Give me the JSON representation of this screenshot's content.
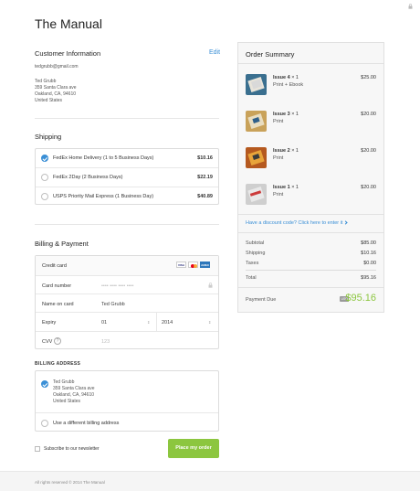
{
  "page": {
    "title": "The Manual"
  },
  "customer": {
    "heading": "Customer Information",
    "edit_label": "Edit",
    "email": "tedgrubb@gmail.com",
    "address_lines": [
      "Ted Grubb",
      "359 Santa Clara ave",
      "Oakland, CA, 94610",
      "United States"
    ]
  },
  "shipping": {
    "heading": "Shipping",
    "options": [
      {
        "label": "FedEx Home Delivery (1 to 5 Business Days)",
        "price": "$10.16",
        "selected": true
      },
      {
        "label": "FedEx 2Day (2 Business Days)",
        "price": "$22.19",
        "selected": false
      },
      {
        "label": "USPS Priority Mail Express (1 Business Day)",
        "price": "$40.89",
        "selected": false
      }
    ]
  },
  "billing": {
    "heading": "Billing & Payment",
    "credit_card_label": "Credit card",
    "card_icons": [
      "visa-card-icon",
      "mastercard-icon",
      "amex-card-icon"
    ],
    "card_brands": [
      "VISA",
      "",
      "AMEX"
    ],
    "card_number_label": "Card number",
    "card_number_placeholder": "•••• •••• •••• ••••",
    "name_label": "Name on card",
    "name_value": "Ted Grubb",
    "expiry_label": "Expiry",
    "expiry_month": "01",
    "expiry_year": "2014",
    "cvv_label": "CVV",
    "cvv_help": "?",
    "cvv_placeholder": "123"
  },
  "billing_address": {
    "heading": "BILLING ADDRESS",
    "same_lines": [
      "Ted Grubb",
      "359 Santa Clara ave",
      "Oakland, CA, 94610",
      "United States"
    ],
    "different_label": "Use a different billing address"
  },
  "newsletter_label": "Subscribe to our newsletter",
  "place_order_label": "Place my order",
  "footer_text": "All rights reserved © 2014 The Manual",
  "summary": {
    "heading": "Order Summary",
    "items": [
      {
        "name": "Issue 4",
        "qty": "× 1",
        "variant": "Print + Ebook",
        "price": "$25.00",
        "colors": [
          "#3a6f8f",
          "#d9d9d9",
          "#e8e4da"
        ]
      },
      {
        "name": "Issue 3",
        "qty": "× 1",
        "variant": "Print",
        "price": "$20.00",
        "colors": [
          "#c9a25a",
          "#e9ddc0",
          "#2f5f8a"
        ]
      },
      {
        "name": "Issue 2",
        "qty": "× 1",
        "variant": "Print",
        "price": "$20.00",
        "colors": [
          "#b5591f",
          "#e8a43a",
          "#3b3b3b"
        ]
      },
      {
        "name": "Issue 1",
        "qty": "× 1",
        "variant": "Print",
        "price": "$20.00",
        "colors": [
          "#cc3b3b",
          "#e9e9e9",
          "#444444"
        ]
      }
    ],
    "discount_link": "Have a discount code? Click here to enter it",
    "subtotal_label": "Subtotal",
    "subtotal": "$85.00",
    "shipping_label": "Shipping",
    "shipping": "$10.16",
    "taxes_label": "Taxes",
    "taxes": "$0.00",
    "total_label": "Total",
    "total": "$95.16",
    "payment_due_label": "Payment Due",
    "currency": "USD",
    "payment_due": "$95.16"
  },
  "colors": {
    "accent": "#3a8fd6",
    "button": "#8cc63f",
    "due": "#8cc63f"
  }
}
